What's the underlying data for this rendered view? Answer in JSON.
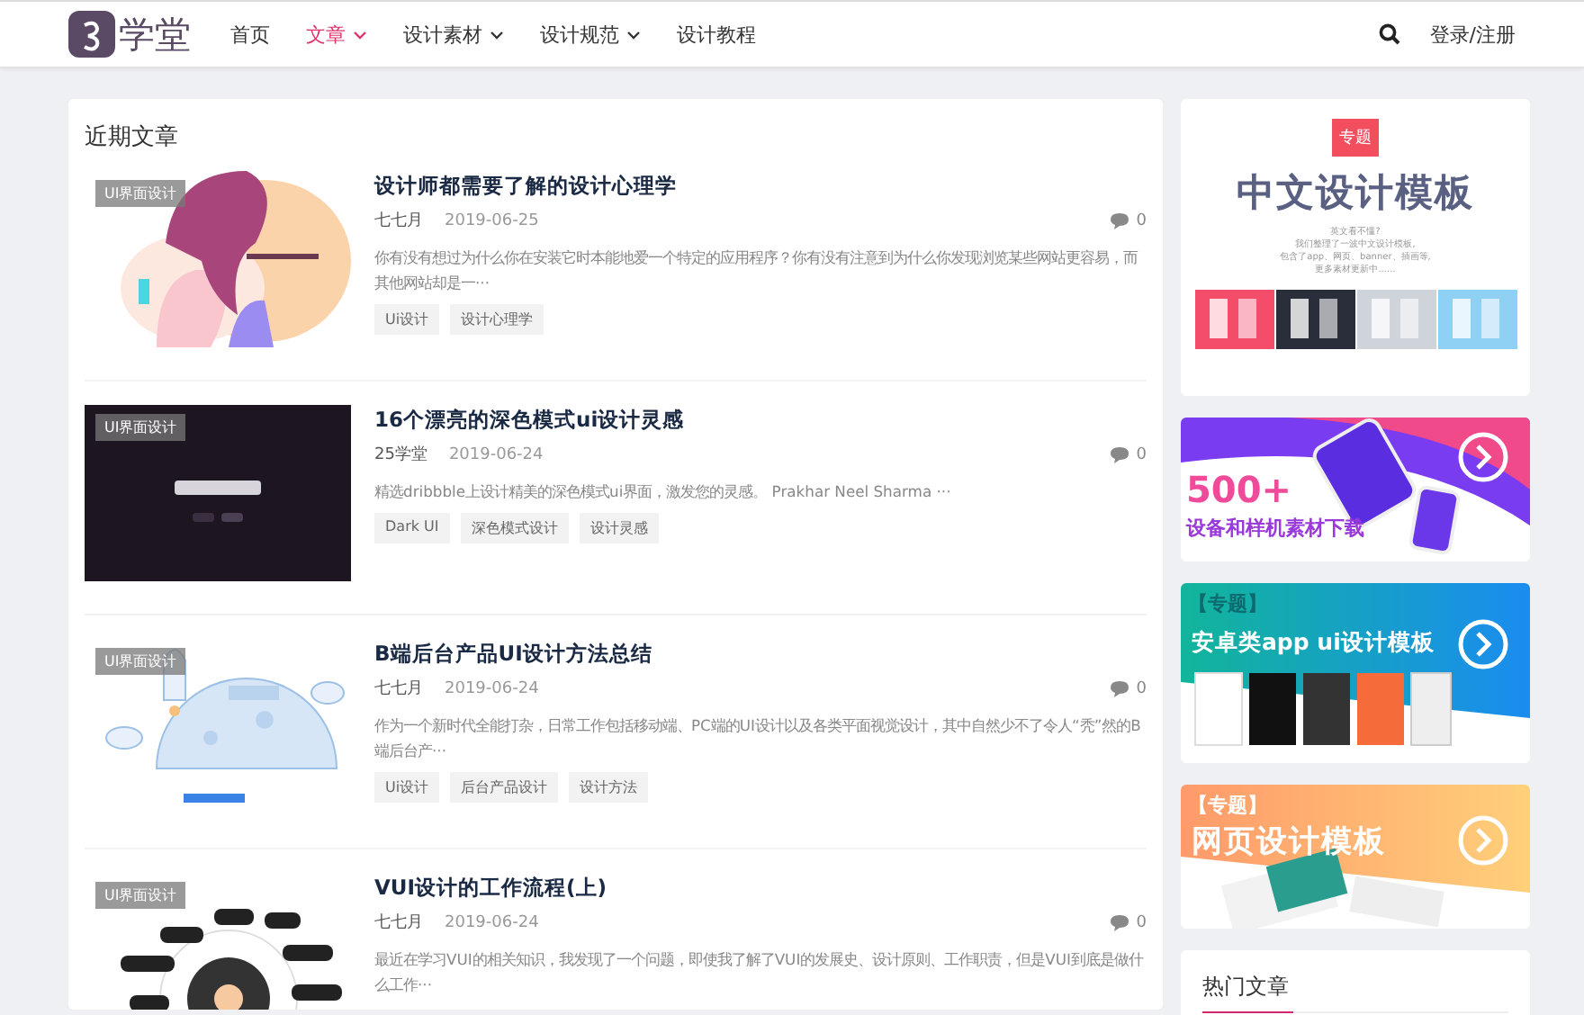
{
  "header": {
    "logo": "学堂",
    "nav": [
      {
        "label": "首页",
        "selected": false,
        "dropdown": false
      },
      {
        "label": "文章",
        "selected": true,
        "dropdown": true
      },
      {
        "label": "设计素材",
        "selected": false,
        "dropdown": true
      },
      {
        "label": "设计规范",
        "selected": false,
        "dropdown": true
      },
      {
        "label": "设计教程",
        "selected": false,
        "dropdown": false
      }
    ],
    "login": "登录/注册"
  },
  "section_title": "近期文章",
  "articles": [
    {
      "category": "UI界面设计",
      "title": "设计师都需要了解的设计心理学",
      "author": "七七月",
      "date": "2019-06-25",
      "comments": "0",
      "excerpt": "你有没有想过为什么你在安装它时本能地爱一个特定的应用程序？你有没有注意到为什么你发现浏览某些网站更容易，而其他网站却是一···",
      "tags": [
        "Ui设计",
        "设计心理学"
      ]
    },
    {
      "category": "UI界面设计",
      "title": "16个漂亮的深色模式ui设计灵感",
      "author": "25学堂",
      "date": "2019-06-24",
      "comments": "0",
      "excerpt": "精选dribbble上设计精美的深色模式ui界面，激发您的灵感。   Prakhar Neel Sharma ···",
      "tags": [
        "Dark UI",
        "深色模式设计",
        "设计灵感"
      ]
    },
    {
      "category": "UI界面设计",
      "title": "B端后台产品UI设计方法总结",
      "author": "七七月",
      "date": "2019-06-24",
      "comments": "0",
      "excerpt": "作为一个新时代全能打杂，日常工作包括移动端、PC端的UI设计以及各类平面视觉设计，其中自然少不了令人“秃”然的B端后台产···",
      "tags": [
        "Ui设计",
        "后台产品设计",
        "设计方法"
      ]
    },
    {
      "category": "UI界面设计",
      "title": "VUI设计的工作流程(上)",
      "author": "七七月",
      "date": "2019-06-24",
      "comments": "0",
      "excerpt": "最近在学习VUI的相关知识，我发现了一个问题，即使我了解了VUI的发展史、设计原则、工作职责，但是VUI到底是做什么工作···"
    }
  ],
  "sidebar": {
    "banners": [
      {
        "kind": "template",
        "badge": "专题",
        "title": "中文设计模板",
        "lines": [
          "英文看不懂?",
          "我们整理了一波中文设计模板,",
          "包含了app、网页、banner、插画等,",
          "更多素材更新中......"
        ]
      },
      {
        "kind": "devices",
        "headline": "500+",
        "title": "设备和样机素材下载"
      },
      {
        "kind": "android",
        "badge": "【专题】",
        "title": "安卓类app ui设计模板"
      },
      {
        "kind": "web",
        "badge": "【专题】",
        "title": "网页设计模板"
      }
    ],
    "hot_title": "热门文章"
  }
}
